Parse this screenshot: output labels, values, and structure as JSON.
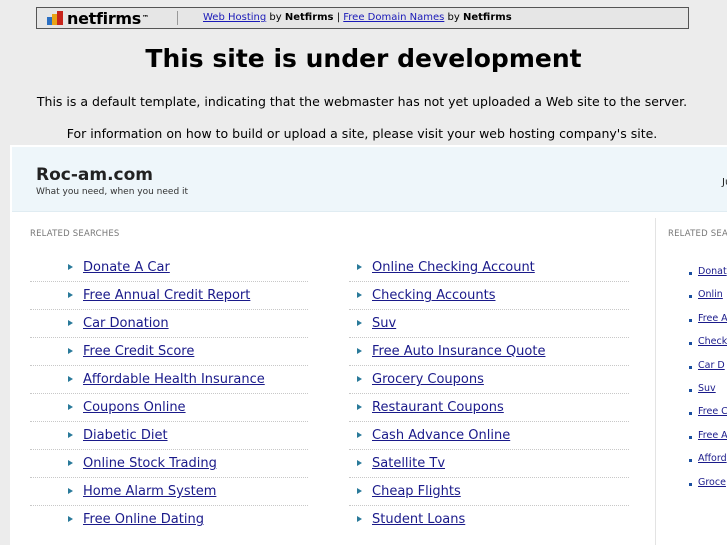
{
  "topbar": {
    "logo_text": "netfirms",
    "logo_tm": "™",
    "link1": "Web Hosting",
    "by1": "by",
    "brand1": "Netfirms",
    "divider": "|",
    "link2": "Free Domain Names",
    "by2": "by",
    "brand2": "Netfirms"
  },
  "heading": "This site is under development",
  "message1": "This is a default template, indicating that the webmaster has not yet uploaded a Web site to the server.",
  "message2": "For information on how to build or upload a site, please visit your web hosting company's site.",
  "parked": {
    "site_name": "Roc-am.com",
    "tagline": "What you need, when you need it",
    "cutoff_text": "Ju",
    "left_label": "RELATED SEARCHES",
    "right_label": "RELATED SEA",
    "col_a": [
      "Donate A Car",
      "Free Annual Credit Report",
      "Car Donation",
      "Free Credit Score",
      "Affordable Health Insurance",
      "Coupons Online",
      "Diabetic Diet",
      "Online Stock Trading",
      "Home Alarm System",
      "Free Online Dating"
    ],
    "col_b": [
      "Online Checking Account",
      "Checking Accounts",
      "Suv",
      "Free Auto Insurance Quote",
      "Grocery Coupons",
      "Restaurant Coupons",
      "Cash Advance Online",
      "Satellite Tv",
      "Cheap Flights",
      "Student Loans"
    ],
    "right_col": [
      "Donat",
      "Onlin",
      "Free A",
      "Check",
      "Car D",
      "Suv",
      "Free C",
      "Free A",
      "Afford",
      "Groce"
    ]
  },
  "colors": {
    "link": "#1a1a8a",
    "arrow": "#2a7a9a",
    "banner_bg": "#eef6fa",
    "page_bg": "#ececec"
  }
}
